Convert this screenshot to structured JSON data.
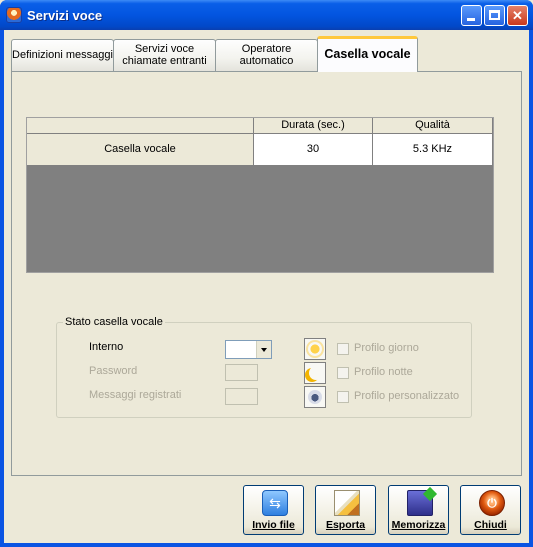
{
  "window": {
    "title": "Servizi voce",
    "controls": {
      "minimize": "minimize",
      "maximize": "maximize",
      "close": "✕"
    }
  },
  "tabs": [
    {
      "line1": "Definizioni messaggi",
      "line2": ""
    },
    {
      "line1": "Servizi voce",
      "line2": "chiamate entranti"
    },
    {
      "line1": "Operatore",
      "line2": "automatico"
    },
    {
      "line1": "Casella vocale",
      "line2": "",
      "active": true
    }
  ],
  "grid": {
    "columns": [
      "",
      "Durata (sec.)",
      "Qualità"
    ],
    "rows": [
      [
        "Casella vocale",
        "30",
        "5.3 KHz"
      ]
    ]
  },
  "status_group": {
    "title": "Stato casella vocale",
    "interno_label": "Interno",
    "interno_value": "",
    "password_label": "Password",
    "messaggi_label": "Messaggi registrati",
    "profiles": [
      {
        "label": "Profilo giorno",
        "icon": "sun-icon",
        "checked": false
      },
      {
        "label": "Profilo notte",
        "icon": "moon-icon",
        "checked": false
      },
      {
        "label": "Profilo personalizzato",
        "icon": "custom-profile-icon",
        "checked": false
      }
    ]
  },
  "buttons": {
    "invio": "Invio file",
    "esporta": "Esporta",
    "memorizza": "Memorizza",
    "chiudi": "Chiudi"
  },
  "colors": {
    "titlebar": "#0355e0",
    "active_tab_accent": "#ffc83c",
    "grid_background": "#808080"
  }
}
